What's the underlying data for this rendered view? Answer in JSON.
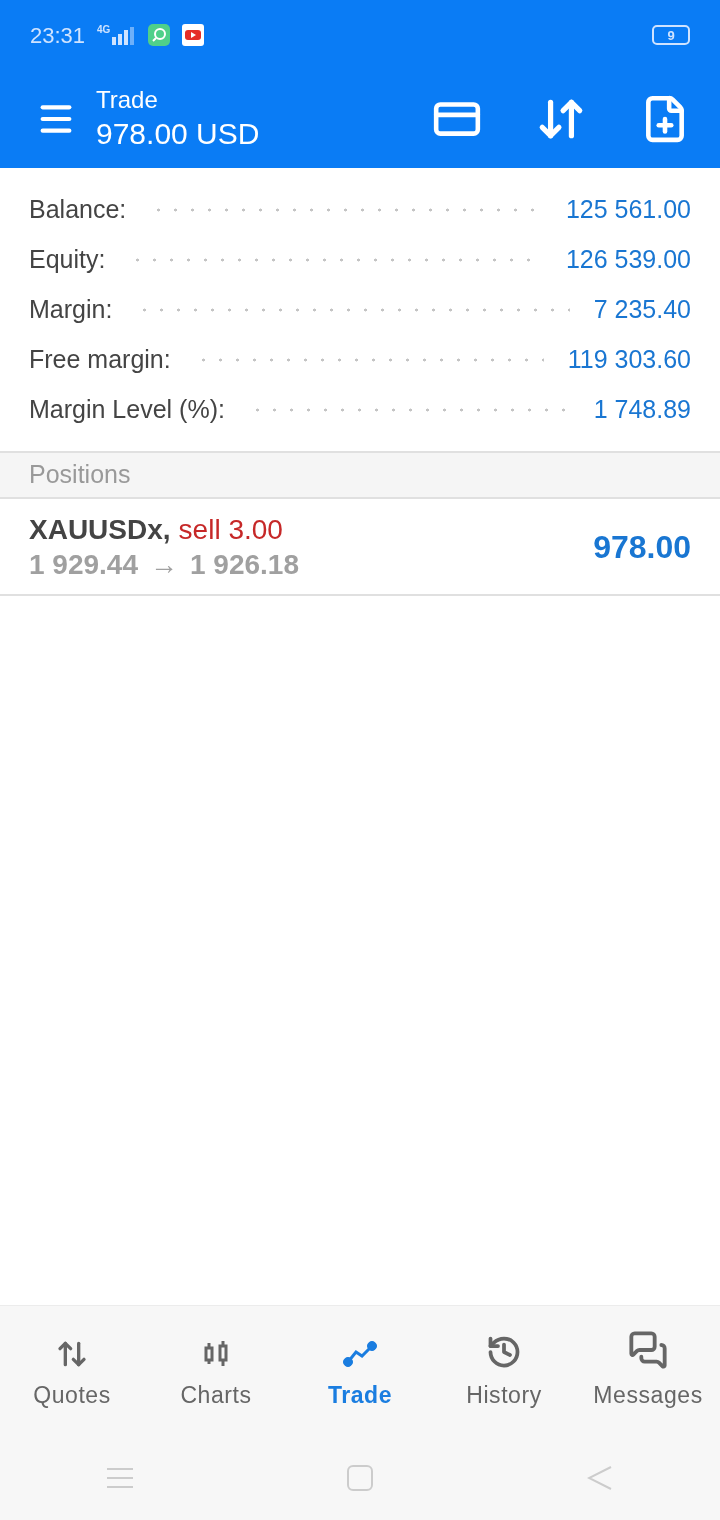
{
  "status_bar": {
    "time": "23:31",
    "network": "4G",
    "battery": "9"
  },
  "header": {
    "title": "Trade",
    "subtitle": "978.00 USD"
  },
  "summary": [
    {
      "label": "Balance:",
      "value": "125 561.00"
    },
    {
      "label": "Equity:",
      "value": "126 539.00"
    },
    {
      "label": "Margin:",
      "value": "7 235.40"
    },
    {
      "label": "Free margin:",
      "value": "119 303.60"
    },
    {
      "label": "Margin Level (%):",
      "value": "1 748.89"
    }
  ],
  "positions": {
    "title": "Positions",
    "items": [
      {
        "symbol": "XAUUSDx,",
        "kind": "sell",
        "volume": "sell 3.00",
        "open_price": "1 929.44",
        "arrow": "→",
        "current_price": "1 926.18",
        "profit": "978.00"
      }
    ]
  },
  "bottom_nav": [
    {
      "label": "Quotes",
      "kind": "quotes",
      "selected": false
    },
    {
      "label": "Charts",
      "kind": "charts",
      "selected": false
    },
    {
      "label": "Trade",
      "kind": "trade",
      "selected": true
    },
    {
      "label": "History",
      "kind": "history",
      "selected": false
    },
    {
      "label": "Messages",
      "kind": "messages",
      "selected": false
    }
  ]
}
